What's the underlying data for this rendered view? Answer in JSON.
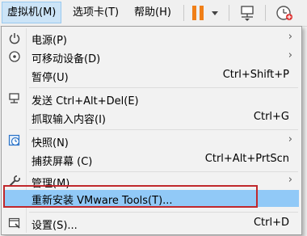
{
  "menubar": {
    "vm": "虚拟机(M)",
    "tabs": "选项卡(T)",
    "help": "帮助(H)"
  },
  "icons": {
    "pause": "pause-icon",
    "network": "network-icon",
    "snapshot": "snapshot-clock-icon"
  },
  "colors": {
    "pause": "#f07f18",
    "highlight": "#91c9f7",
    "annotation": "#c0282c"
  },
  "menu": {
    "power": {
      "label": "电源(P)"
    },
    "removable": {
      "label": "可移动设备(D)"
    },
    "pause": {
      "label": "暂停(U)",
      "shortcut": "Ctrl+Shift+P"
    },
    "send_cad": {
      "label": "发送 Ctrl+Alt+Del(E)"
    },
    "grab_input": {
      "label": "抓取输入内容(I)",
      "shortcut": "Ctrl+G"
    },
    "snapshot": {
      "label": "快照(N)"
    },
    "capture_screen": {
      "label": "捕获屏幕 (C)",
      "shortcut": "Ctrl+Alt+PrtScn"
    },
    "manage": {
      "label": "管理(M)"
    },
    "reinstall_tools": {
      "label": "重新安装 VMware Tools(T)..."
    },
    "settings": {
      "label": "设置(S)...",
      "shortcut": "Ctrl+D"
    }
  }
}
